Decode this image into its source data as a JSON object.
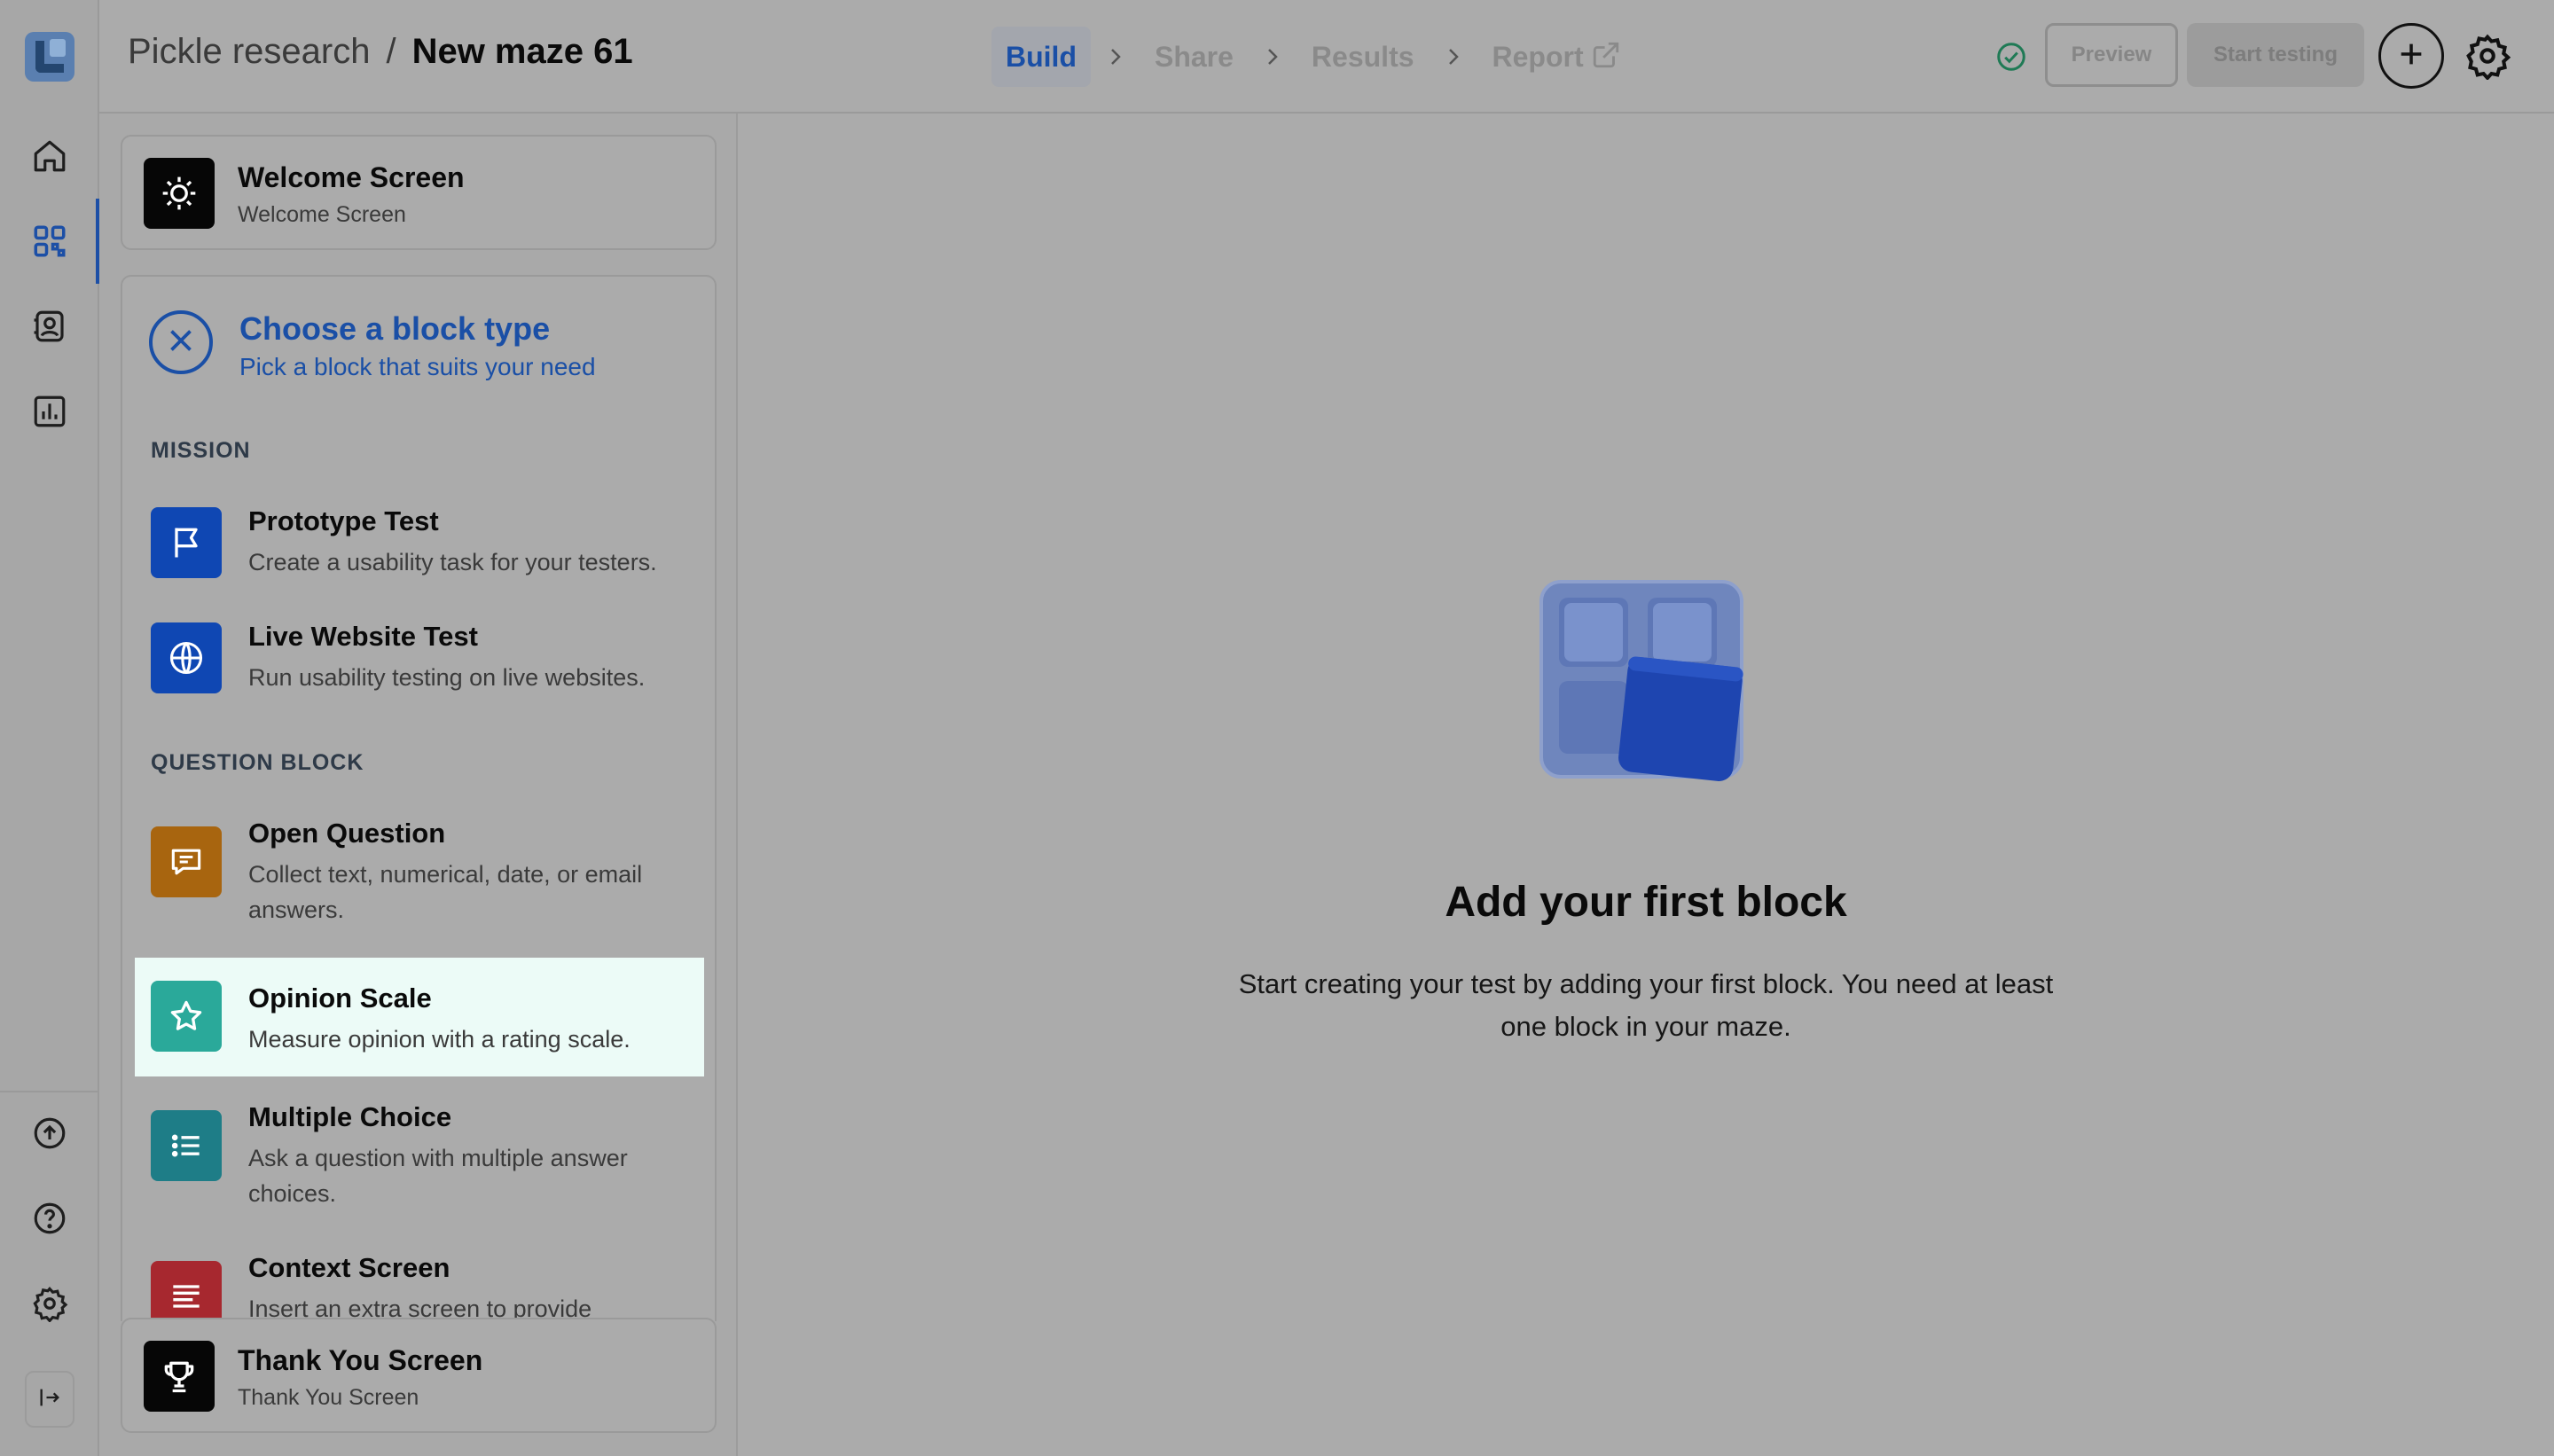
{
  "app": {
    "breadcrumb": {
      "project": "Pickle research",
      "separator": "/",
      "maze": "New maze 61"
    }
  },
  "steps": [
    {
      "label": "Build",
      "active": true
    },
    {
      "label": "Share",
      "active": false
    },
    {
      "label": "Results",
      "active": false
    },
    {
      "label": "Report",
      "active": false,
      "icon": "external-link-icon"
    }
  ],
  "header": {
    "status_icon": "check-circle-icon",
    "preview_label": "Preview",
    "start_label": "Start testing",
    "add_icon": "plus-icon",
    "settings_icon": "gear-icon"
  },
  "rail": {
    "top": [
      "home-icon",
      "dashboard-icon",
      "contacts-icon",
      "analytics-icon"
    ],
    "bottom": [
      "upload-icon",
      "help-icon",
      "gear-icon"
    ],
    "collapse_icon": "collapse-icon",
    "active": "dashboard-icon"
  },
  "panel": {
    "welcome": {
      "title": "Welcome Screen",
      "subtitle": "Welcome Screen",
      "icon": "sun-icon"
    },
    "chooser": {
      "title": "Choose a block type",
      "subtitle": "Pick a block that suits your need",
      "sections": [
        {
          "label": "MISSION",
          "items": [
            {
              "name": "Prototype Test",
              "desc": "Create a usability task for your testers.",
              "icon": "flag-icon",
              "color": "#0f47b3"
            },
            {
              "name": "Live Website Test",
              "desc": "Run usability testing on live websites.",
              "icon": "globe-icon",
              "color": "#0f47b3"
            }
          ]
        },
        {
          "label": "QUESTION BLOCK",
          "items": [
            {
              "name": "Open Question",
              "desc": "Collect text, numerical, date, or email answers.",
              "icon": "message-icon",
              "color": "#a8650f"
            },
            {
              "name": "Opinion Scale",
              "desc": "Measure opinion with a rating scale.",
              "icon": "star-icon",
              "color": "#2aa99a",
              "highlighted": true
            },
            {
              "name": "Multiple Choice",
              "desc": "Ask a question with multiple answer choices.",
              "icon": "list-icon",
              "color": "#1e7d87"
            },
            {
              "name": "Context Screen",
              "desc": "Insert an extra screen to provide",
              "icon": "text-lines-icon",
              "color": "#a7282f"
            }
          ]
        }
      ]
    },
    "thankyou": {
      "title": "Thank You Screen",
      "subtitle": "Thank You Screen",
      "icon": "trophy-icon"
    }
  },
  "main": {
    "illustration": "blocks-illustration",
    "title": "Add your first block",
    "description": "Start creating your test by adding your first block. You need at least one block in your maze."
  },
  "colors": {
    "accent": "#1a4fa6",
    "overlay": "#ababab",
    "highlight": "#ecfbf7"
  }
}
